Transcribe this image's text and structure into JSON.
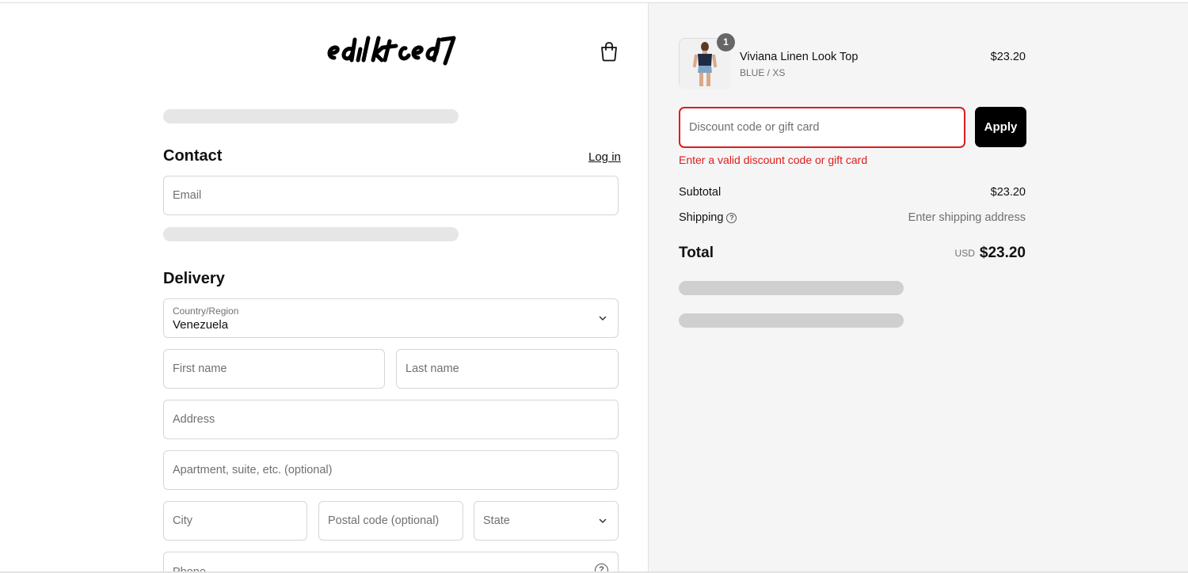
{
  "brand": {
    "logo_text": "edikted"
  },
  "contact": {
    "heading": "Contact",
    "login_label": "Log in",
    "email_placeholder": "Email"
  },
  "delivery": {
    "heading": "Delivery",
    "country_label": "Country/Region",
    "country_value": "Venezuela",
    "first_name_placeholder": "First name",
    "last_name_placeholder": "Last name",
    "address_placeholder": "Address",
    "apartment_placeholder": "Apartment, suite, etc. (optional)",
    "city_placeholder": "City",
    "postal_placeholder": "Postal code (optional)",
    "state_placeholder": "State",
    "phone_placeholder": "Phone"
  },
  "order": {
    "item": {
      "quantity": "1",
      "name": "Viviana Linen Look Top",
      "variant": "BLUE / XS",
      "price": "$23.20"
    },
    "discount_placeholder": "Discount code or gift card",
    "apply_label": "Apply",
    "discount_error": "Enter a valid discount code or gift card",
    "subtotal_label": "Subtotal",
    "subtotal_value": "$23.20",
    "shipping_label": "Shipping",
    "shipping_value": "Enter shipping address",
    "total_label": "Total",
    "currency": "USD",
    "total_value": "$23.20"
  },
  "colors": {
    "accent": "#000000",
    "error": "#dd1d1d",
    "sidebar_bg": "#f5f5f5"
  }
}
